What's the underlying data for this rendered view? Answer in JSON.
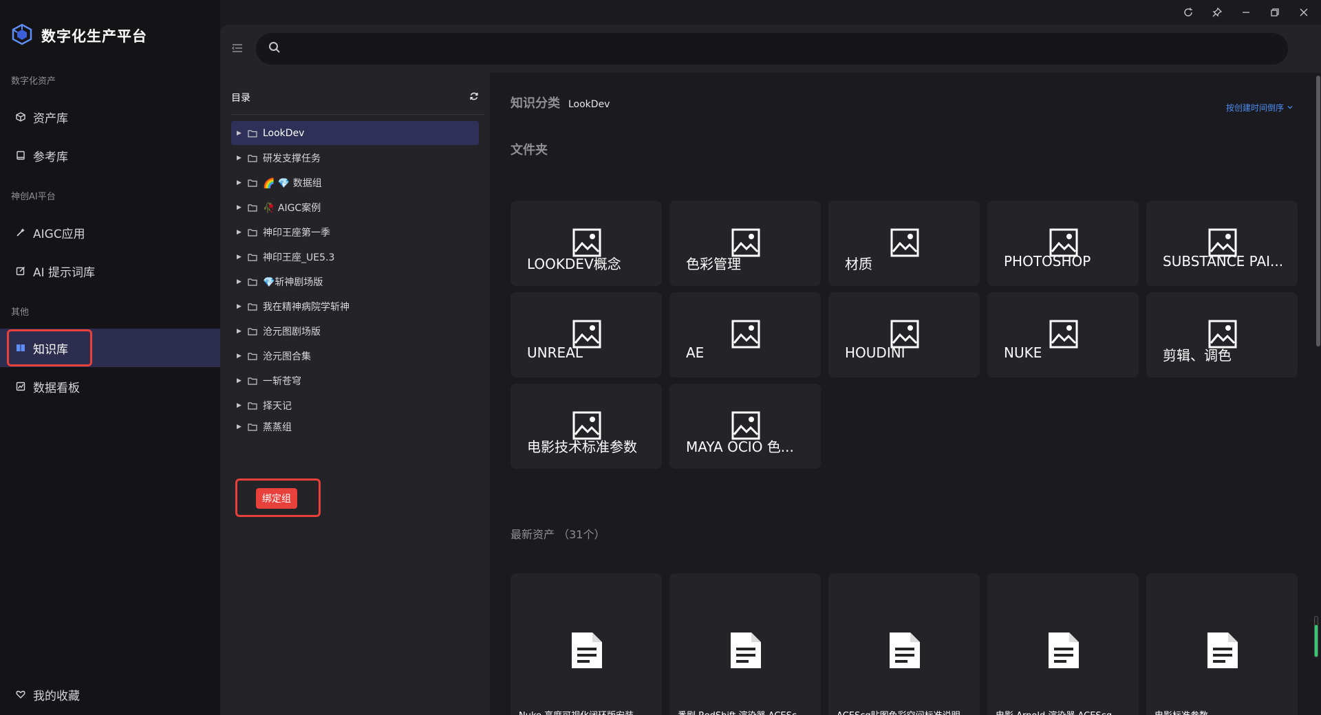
{
  "brand": {
    "title": "数字化生产平台"
  },
  "sidebar": {
    "sections": [
      {
        "title": "数字化资产",
        "items": [
          {
            "label": "资产库",
            "icon": "cube-icon"
          },
          {
            "label": "参考库",
            "icon": "book-icon"
          }
        ]
      },
      {
        "title": "神创AI平台",
        "items": [
          {
            "label": "AIGC应用",
            "icon": "magic-wand-icon"
          },
          {
            "label": "AI 提示词库",
            "icon": "edit-icon"
          }
        ]
      },
      {
        "title": "其他",
        "items": [
          {
            "label": "知识库",
            "icon": "knowledge-book-icon",
            "active": true
          },
          {
            "label": "数据看板",
            "icon": "chart-icon"
          }
        ]
      }
    ],
    "favorites": "我的收藏"
  },
  "search": {
    "placeholder": "",
    "value": ""
  },
  "directory": {
    "title": "目录",
    "items": [
      {
        "label": "LookDev",
        "selected": true
      },
      {
        "label": "研发支撑任务"
      },
      {
        "label": "🌈 💎 数据组"
      },
      {
        "label": "🥀 AIGC案例"
      },
      {
        "label": "神印王座第一季"
      },
      {
        "label": "神印王座_UE5.3"
      },
      {
        "label": "💎斩神剧场版"
      },
      {
        "label": "我在精神病院学斩神"
      },
      {
        "label": "沧元图剧场版"
      },
      {
        "label": "沧元图合集"
      },
      {
        "label": "一斩苍穹"
      },
      {
        "label": "择天记"
      },
      {
        "label": "蒸蒸组"
      }
    ],
    "bind_button": "绑定组"
  },
  "content": {
    "crumb_label": "知识分类",
    "crumb_value": "LookDev",
    "sort_label": "按创建时间倒序",
    "folders_title": "文件夹",
    "folders": [
      "LOOKDEV概念",
      "色彩管理",
      "材质",
      "PHOTOSHOP",
      "SUBSTANCE PAI...",
      "UNREAL",
      "AE",
      "HOUDINI",
      "NUKE",
      "剪辑、调色",
      "电影技术标准参数",
      "MAYA OCIO 色..."
    ],
    "assets_title": "最新资产 （31个）",
    "assets": [
      "Nuke 高度可视化闭环版安装",
      "番剧 RedShift 渲染器 ACESc",
      "ACEScg贴图色彩空间标准说明",
      "电影 Arnold 渲染器 ACEScg",
      "电影标准参数"
    ]
  },
  "colors": {
    "accent": "#4a8cf0",
    "active_bg": "#2c2d4f",
    "highlight": "#e8403a",
    "selected_tree": "#2f3057"
  },
  "progress": {
    "fill_percent": 80
  }
}
